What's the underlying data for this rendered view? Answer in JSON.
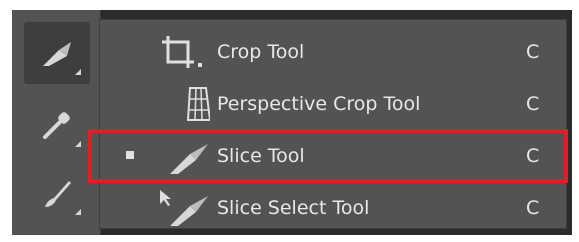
{
  "menu": {
    "items": [
      {
        "label": "Crop Tool",
        "shortcut": "C",
        "icon": "crop-icon",
        "selected": false
      },
      {
        "label": "Perspective Crop Tool",
        "shortcut": "C",
        "icon": "perspective-crop-icon",
        "selected": false
      },
      {
        "label": "Slice Tool",
        "shortcut": "C",
        "icon": "slice-icon",
        "selected": true
      },
      {
        "label": "Slice Select Tool",
        "shortcut": "C",
        "icon": "slice-select-icon",
        "selected": false
      }
    ]
  },
  "toolbar": {
    "tools": [
      {
        "icon": "slice-icon",
        "active": true
      },
      {
        "icon": "eyedropper-icon",
        "active": false
      },
      {
        "icon": "brush-icon",
        "active": false
      }
    ]
  },
  "colors": {
    "panel": "#535353",
    "text": "#e8e8e8",
    "highlight": "#e01e26"
  }
}
